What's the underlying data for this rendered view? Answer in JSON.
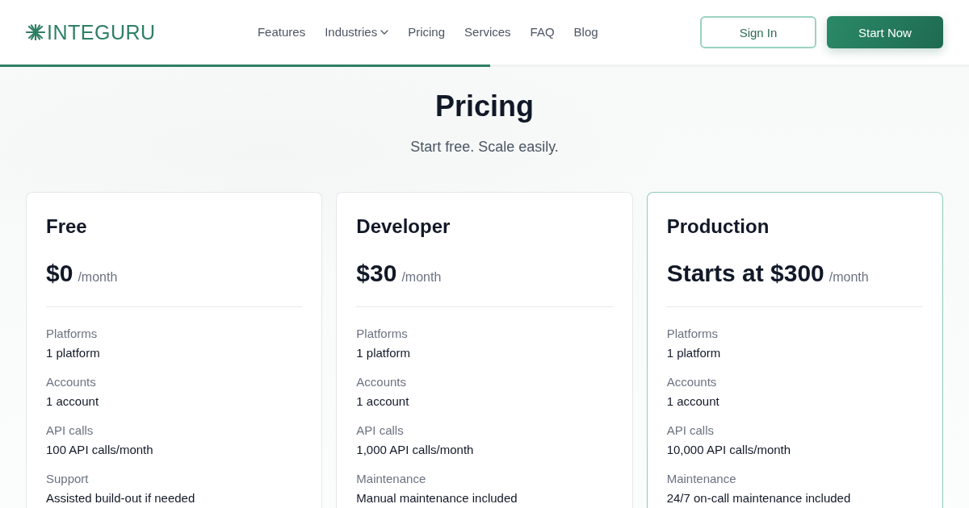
{
  "brand": {
    "name": "INTEGURU"
  },
  "nav": {
    "links": [
      {
        "label": "Features",
        "dropdown": false
      },
      {
        "label": "Industries",
        "dropdown": true
      },
      {
        "label": "Pricing",
        "dropdown": false
      },
      {
        "label": "Services",
        "dropdown": false
      },
      {
        "label": "FAQ",
        "dropdown": false
      },
      {
        "label": "Blog",
        "dropdown": false
      }
    ]
  },
  "actions": [
    {
      "label": "Sign In",
      "kind": "outline"
    },
    {
      "label": "Start Now",
      "kind": "primary"
    }
  ],
  "scroll_progress": {
    "level": 0.506
  },
  "hero": {
    "title": "Pricing",
    "subtitle": "Start free. Scale easily."
  },
  "plans": [
    {
      "name": "Free",
      "price": "$0",
      "period": "/month",
      "highlighted": false,
      "features": [
        {
          "label": "Platforms",
          "value": "1 platform"
        },
        {
          "label": "Accounts",
          "value": "1 account"
        },
        {
          "label": "API calls",
          "value": "100 API calls/month"
        },
        {
          "label": "Support",
          "value": "Assisted build-out if needed"
        }
      ]
    },
    {
      "name": "Developer",
      "price": "$30",
      "period": "/month",
      "highlighted": false,
      "features": [
        {
          "label": "Platforms",
          "value": "1 platform"
        },
        {
          "label": "Accounts",
          "value": "1 account"
        },
        {
          "label": "API calls",
          "value": "1,000 API calls/month"
        },
        {
          "label": "Maintenance",
          "value": "Manual maintenance included"
        }
      ]
    },
    {
      "name": "Production",
      "price": "Starts at $300",
      "period": "/month",
      "highlighted": true,
      "features": [
        {
          "label": "Platforms",
          "value": "1 platform"
        },
        {
          "label": "Accounts",
          "value": "1 account"
        },
        {
          "label": "API calls",
          "value": "10,000 API calls/month"
        },
        {
          "label": "Maintenance",
          "value": "24/7 on-call maintenance included"
        }
      ]
    }
  ]
}
